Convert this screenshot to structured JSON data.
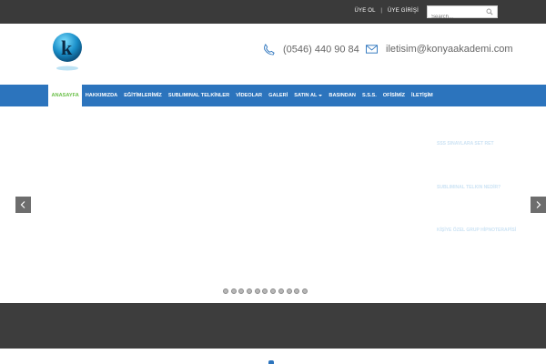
{
  "topbar": {
    "register_label": "ÜYE OL",
    "separator": "|",
    "login_label": "ÜYE GİRİŞİ",
    "search_placeholder": "Search..."
  },
  "header": {
    "phone": "(0546) 440 90 84",
    "email": "iletisim@konyaakademi.com",
    "logo_icon": "k-logo-globe"
  },
  "nav": {
    "items": [
      {
        "label": "ANASAYFA",
        "active": true
      },
      {
        "label": "HAKKIMIZDA"
      },
      {
        "label": "EĞİTİMLERİMİZ"
      },
      {
        "label": "SUBLIMINAL TELKİNLER"
      },
      {
        "label": "VİDEOLAR"
      },
      {
        "label": "GALERİ"
      },
      {
        "label": "SATIN AL",
        "dropdown": true
      },
      {
        "label": "BASINDAN"
      },
      {
        "label": "S.S.S."
      },
      {
        "label": "OFİSİMİZ"
      },
      {
        "label": "İLETİŞİM"
      }
    ]
  },
  "slider": {
    "links": [
      "SSS SINAVLARA SET RET",
      "SUBLIMINAL TELKIN NEDİR?",
      "KİŞİYE ÖZEL GRUP HİPNOTERAPİSİ"
    ],
    "dot_count": 11
  },
  "colors": {
    "topbar": "#3a3a3a",
    "nav": "#2c74bd",
    "active_text": "#6cc04a",
    "band": "#3d3d3d"
  }
}
